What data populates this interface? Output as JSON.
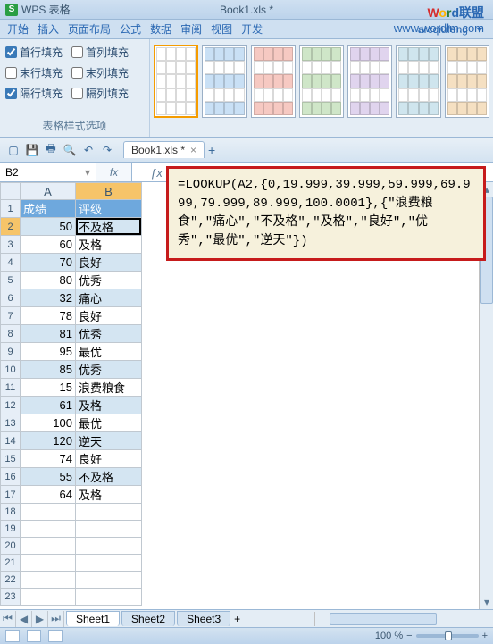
{
  "title": {
    "app": "WPS 表格",
    "doc": "Book1.xls *",
    "icon_letter": "S"
  },
  "watermark": {
    "text1": [
      "W",
      "o",
      "r",
      "d",
      "联盟"
    ],
    "text2": "www.wordlm.com"
  },
  "menu": {
    "items": [
      "开始",
      "插入",
      "页面布局",
      "公式",
      "数据",
      "审阅",
      "视图",
      "开发"
    ],
    "account": "arcqiufeng",
    "dropdown": "▾"
  },
  "ribbon": {
    "group1": {
      "label": "表格样式选项",
      "checks": [
        {
          "label": "首行填充",
          "checked": true
        },
        {
          "label": "首列填充",
          "checked": false
        },
        {
          "label": "末行填充",
          "checked": false
        },
        {
          "label": "末列填充",
          "checked": false
        },
        {
          "label": "隔行填充",
          "checked": true
        },
        {
          "label": "隔列填充",
          "checked": false
        }
      ]
    }
  },
  "qat": {
    "tab_label": "Book1.xls *",
    "tab_close": "×",
    "add": "+"
  },
  "formula_bar": {
    "namebox": "B2",
    "fx": "fx",
    "formula_text": "=LOOKUP(A2,{0,19.999,39.999,59.999,69.999,79.999,89.999,100.0001},{\"浪费粮食\",\"痛心\",\"不及格\",\"及格\",\"良好\",\"优秀\",\"最优\",\"逆天\"})"
  },
  "columns": [
    "A",
    "B"
  ],
  "rows": [
    {
      "n": 1,
      "a": "成绩",
      "b": "评级",
      "hdr": true
    },
    {
      "n": 2,
      "a": "50",
      "b": "不及格",
      "sel": true
    },
    {
      "n": 3,
      "a": "60",
      "b": "及格"
    },
    {
      "n": 4,
      "a": "70",
      "b": "良好"
    },
    {
      "n": 5,
      "a": "80",
      "b": "优秀"
    },
    {
      "n": 6,
      "a": "32",
      "b": "痛心"
    },
    {
      "n": 7,
      "a": "78",
      "b": "良好"
    },
    {
      "n": 8,
      "a": "81",
      "b": "优秀"
    },
    {
      "n": 9,
      "a": "95",
      "b": "最优"
    },
    {
      "n": 10,
      "a": "85",
      "b": "优秀"
    },
    {
      "n": 11,
      "a": "15",
      "b": "浪费粮食"
    },
    {
      "n": 12,
      "a": "61",
      "b": "及格"
    },
    {
      "n": 13,
      "a": "100",
      "b": "最优"
    },
    {
      "n": 14,
      "a": "120",
      "b": "逆天"
    },
    {
      "n": 15,
      "a": "74",
      "b": "良好"
    },
    {
      "n": 16,
      "a": "55",
      "b": "不及格"
    },
    {
      "n": 17,
      "a": "64",
      "b": "及格"
    },
    {
      "n": 18,
      "a": "",
      "b": ""
    },
    {
      "n": 19,
      "a": "",
      "b": ""
    },
    {
      "n": 20,
      "a": "",
      "b": ""
    },
    {
      "n": 21,
      "a": "",
      "b": ""
    },
    {
      "n": 22,
      "a": "",
      "b": ""
    },
    {
      "n": 23,
      "a": "",
      "b": ""
    }
  ],
  "sheets": {
    "tabs": [
      "Sheet1",
      "Sheet2",
      "Sheet3"
    ],
    "add": "+"
  },
  "status": {
    "zoom": "100 %",
    "minus": "−",
    "plus": "+"
  },
  "style_colors": [
    "#d0d4d8",
    "#c9e0f5",
    "#f6c9c2",
    "#cfe6c8",
    "#e0d4ee",
    "#cfe5ee",
    "#f5e0c2"
  ]
}
